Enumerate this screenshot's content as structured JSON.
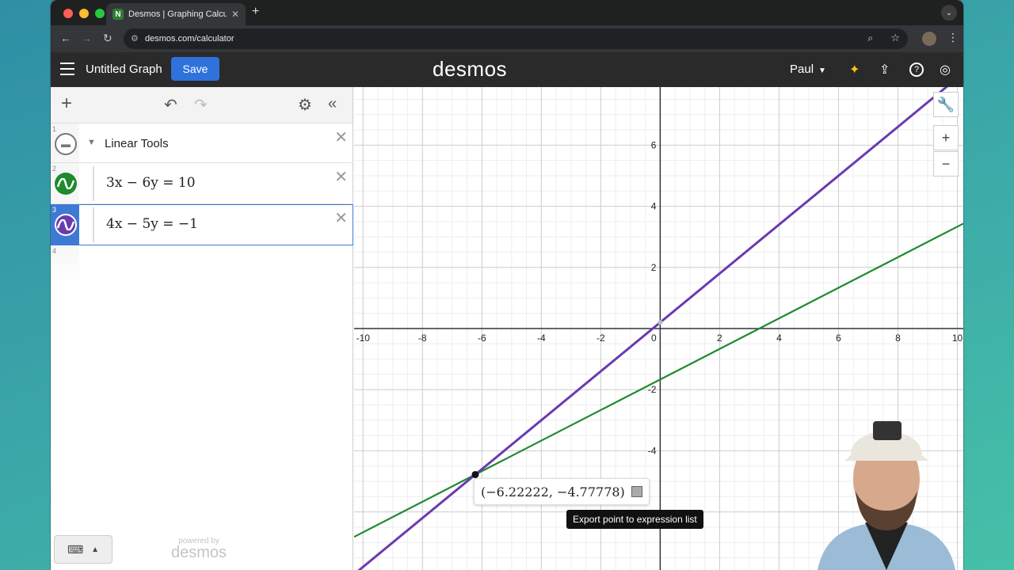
{
  "browser": {
    "tab_title": "Desmos | Graphing Calculator",
    "url": "desmos.com/calculator"
  },
  "header": {
    "graph_title": "Untitled Graph",
    "save_label": "Save",
    "logo": "desmos",
    "user": "Paul"
  },
  "expressions": [
    {
      "num": "1",
      "type": "folder",
      "label": "Linear Tools"
    },
    {
      "num": "2",
      "type": "equation",
      "color": "#1f8a2e",
      "latex": "3x − 6y = 10"
    },
    {
      "num": "3",
      "type": "equation",
      "color": "#6a3ab0",
      "latex": "4x − 5y = −1",
      "selected": true
    },
    {
      "num": "4",
      "type": "empty"
    }
  ],
  "footer": {
    "powered_by": "powered by",
    "brand": "desmos"
  },
  "graph": {
    "x_ticks": [
      "-10",
      "-8",
      "-6",
      "-4",
      "-2",
      "0",
      "2",
      "4",
      "6",
      "8",
      "10"
    ],
    "y_ticks": [
      "6",
      "4",
      "2",
      "-2",
      "-4"
    ],
    "x_range": [
      -10.3,
      10.2
    ],
    "y_range": [
      -7.9,
      7.9
    ],
    "lines": [
      {
        "name": "3x − 6y = 10",
        "color": "#1f8a2e",
        "a": 3,
        "b": -6,
        "c": 10
      },
      {
        "name": "4x − 5y = −1",
        "color": "#6a3ab0",
        "a": 4,
        "b": -5,
        "c": -1
      }
    ],
    "intersection": {
      "x": -6.22222,
      "y": -4.77778,
      "label": "(−6.22222, −4.77778)"
    },
    "tooltip": "Export point to expression list"
  }
}
